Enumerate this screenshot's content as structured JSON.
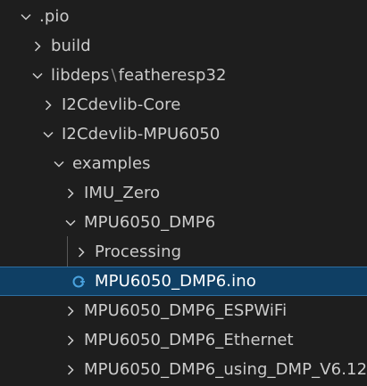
{
  "explorer": {
    "items": [
      {
        "label": ".pio",
        "expanded": true
      },
      {
        "label": "build",
        "expanded": false
      },
      {
        "label_a": "libdeps",
        "separator": "\\",
        "label_b": "featheresp32",
        "expanded": true
      },
      {
        "label": "I2Cdevlib-Core",
        "expanded": false
      },
      {
        "label": "I2Cdevlib-MPU6050",
        "expanded": true
      },
      {
        "label": "examples",
        "expanded": true
      },
      {
        "label": "IMU_Zero",
        "expanded": false
      },
      {
        "label": "MPU6050_DMP6",
        "expanded": true
      },
      {
        "label": "Processing",
        "expanded": false
      },
      {
        "label": "MPU6050_DMP6.ino",
        "type": "file",
        "icon": "arduino-file-icon",
        "selected": true
      },
      {
        "label": "MPU6050_DMP6_ESPWiFi",
        "expanded": false
      },
      {
        "label": "MPU6050_DMP6_Ethernet",
        "expanded": false
      },
      {
        "label": "MPU6050_DMP6_using_DMP_V6.12",
        "expanded": false
      }
    ]
  },
  "colors": {
    "background": "#1e1e1e",
    "text": "#cccccc",
    "selected_bg": "#0f3f64",
    "selected_border": "#2d6ea0",
    "icon_accent": "#4aa3df"
  }
}
